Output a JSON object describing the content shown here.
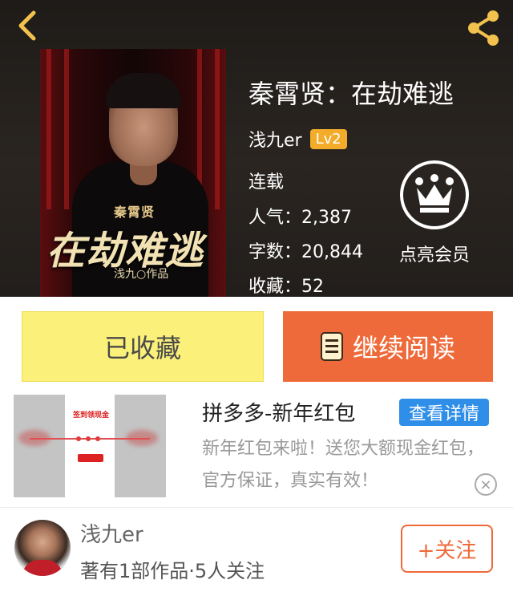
{
  "header": {
    "back_icon": "chevron-left-icon",
    "share_icon": "share-icon",
    "icon_color": "#f2c14e"
  },
  "book": {
    "cover": {
      "small_title": "秦霄贤",
      "big_title": "在劫难逃",
      "author_line": "浅九○作品"
    },
    "title": "秦霄贤：在劫难逃",
    "author": "浅九er",
    "level": "Lv2",
    "status": "连载",
    "popularity": "人气：2,387",
    "word_count": "字数：20,844",
    "favorites": "收藏：52"
  },
  "member": {
    "icon": "crown-icon",
    "label": "点亮会员"
  },
  "actions": {
    "collected_label": "已收藏",
    "read_label": "继续阅读",
    "read_icon": "book-icon"
  },
  "ad": {
    "image_text": "签到领现金",
    "title": "拼多多-新年红包",
    "detail_button": "查看详情",
    "description": "新年红包来啦！送您大额现金红包，官方保证，真实有效！",
    "close_icon": "close-icon"
  },
  "author_section": {
    "name": "浅九er",
    "info": "著有1部作品·5人关注",
    "follow_button": "+关注"
  },
  "colors": {
    "accent_orange": "#ef6a3a",
    "collected_yellow": "#fbf07a",
    "level_badge": "#f2ac2a",
    "detail_blue": "#2f8ee8"
  }
}
